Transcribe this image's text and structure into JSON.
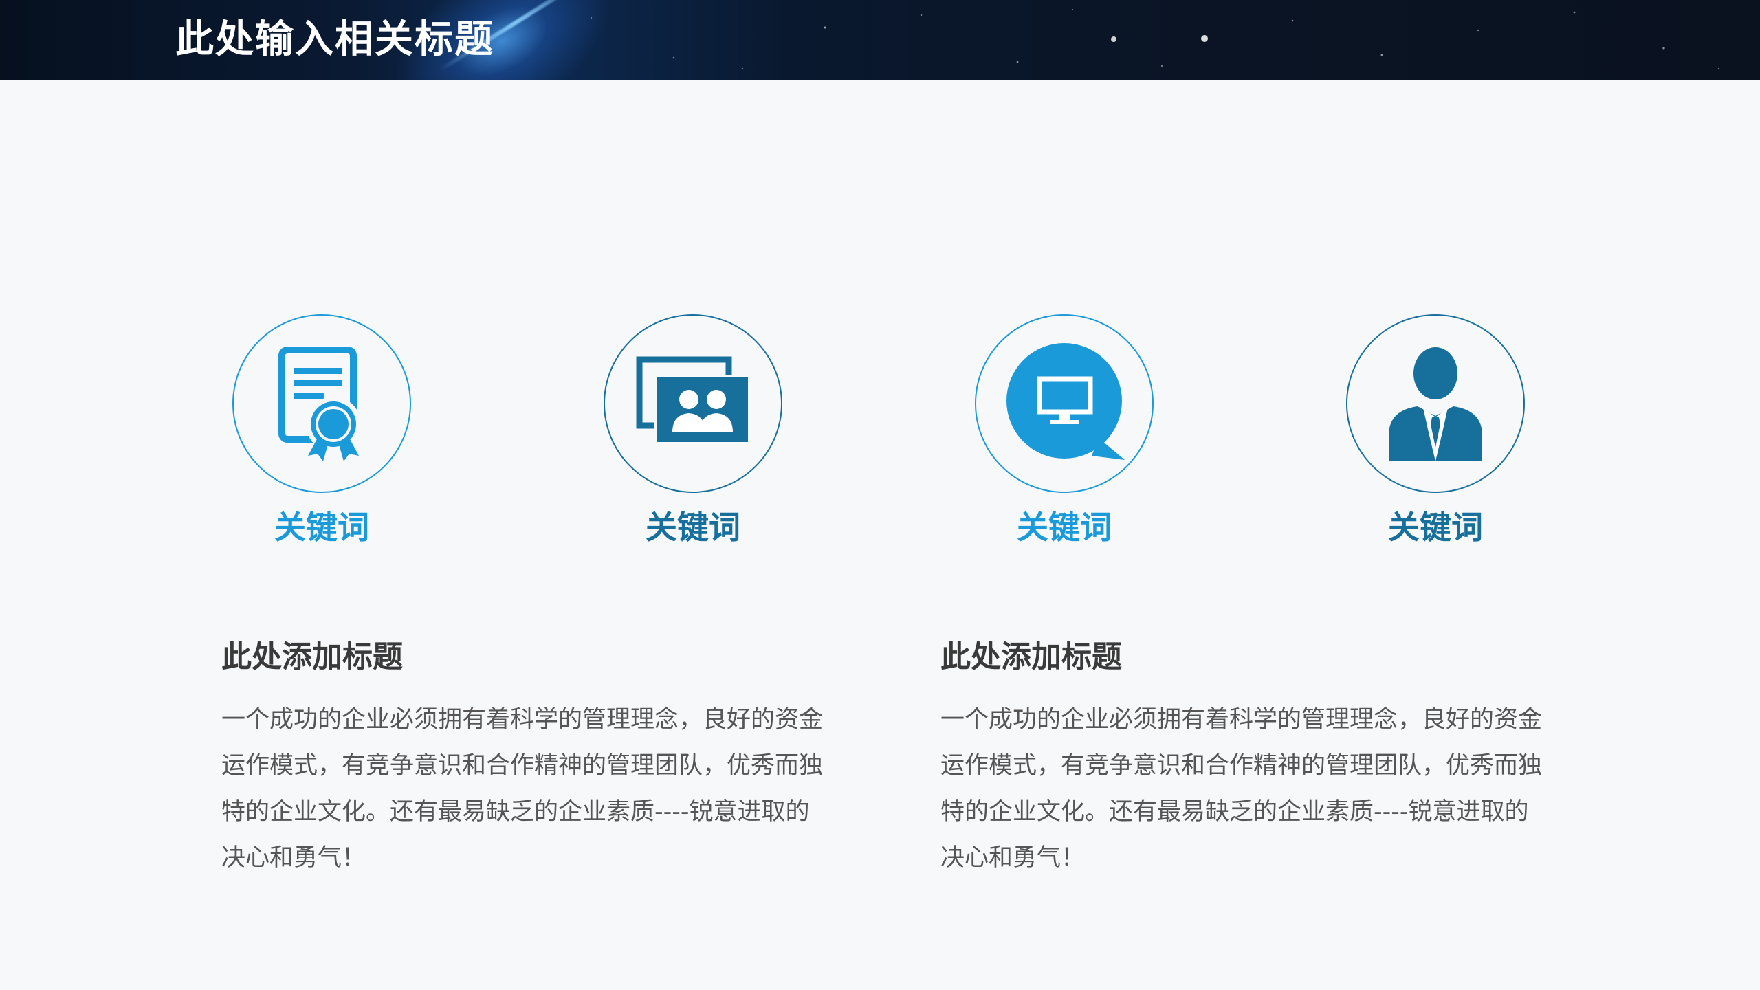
{
  "header": {
    "title": "此处输入相关标题"
  },
  "features": [
    {
      "keyword": "关键词",
      "icon": "certificate-icon"
    },
    {
      "keyword": "关键词",
      "icon": "team-photo-icon"
    },
    {
      "keyword": "关键词",
      "icon": "monitor-chat-bubble-icon"
    },
    {
      "keyword": "关键词",
      "icon": "businessman-icon"
    }
  ],
  "sections": [
    {
      "title": "此处添加标题",
      "body": "一个成功的企业必须拥有着科学的管理理念，良好的资金运作模式，有竞争意识和合作精神的管理团队，优秀而独特的企业文化。还有最易缺乏的企业素质----锐意进取的决心和勇气！"
    },
    {
      "title": "此处添加标题",
      "body": "一个成功的企业必须拥有着科学的管理理念，良好的资金运作模式，有竞争意识和合作精神的管理团队，优秀而独特的企业文化。还有最易缺乏的企业素质----锐意进取的决心和勇气！"
    }
  ],
  "colors": {
    "accent": "#1a9ad8",
    "accent_dark": "#176f9c",
    "banner": "#0a1424"
  }
}
